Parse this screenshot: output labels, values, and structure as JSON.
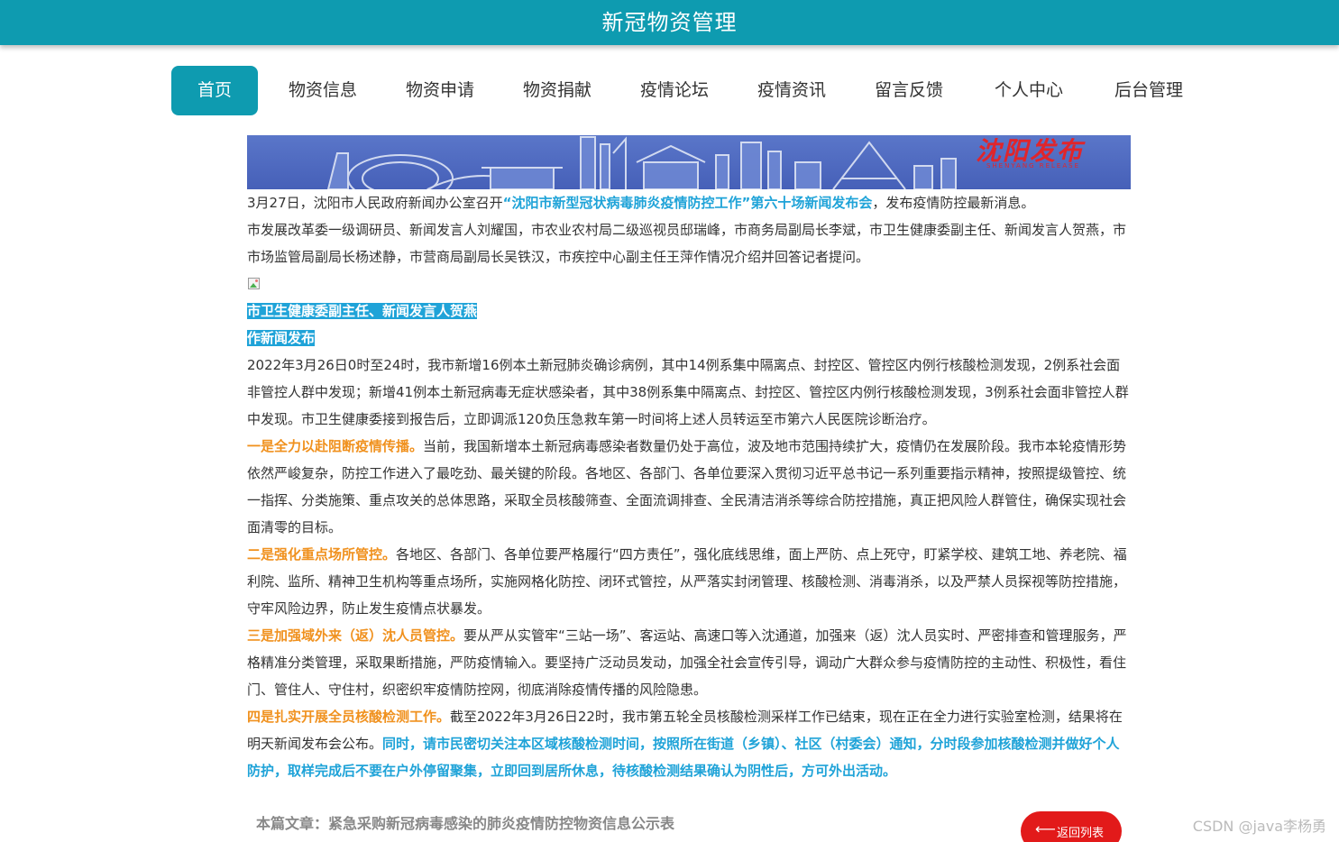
{
  "header": {
    "title": "新冠物资管理",
    "bg_color": "#0e9bb0"
  },
  "nav": {
    "items": [
      {
        "label": "首页",
        "active": true
      },
      {
        "label": "物资信息"
      },
      {
        "label": "物资申请"
      },
      {
        "label": "物资捐献"
      },
      {
        "label": "疫情论坛"
      },
      {
        "label": "疫情资讯"
      },
      {
        "label": "留言反馈"
      },
      {
        "label": "个人中心"
      },
      {
        "label": "后台管理"
      }
    ]
  },
  "banner": {
    "brand": "沈阳发布",
    "brand_sub": "SHENYANG RELEASE"
  },
  "article": {
    "intro_1": "3月27日，沈阳市人民政府新闻办公室召开",
    "intro_link": "“沈阳市新型冠状病毒肺炎疫情防控工作”第六十场新闻发布会",
    "intro_2": "，发布疫情防控最新消息。",
    "speakers": "市发展改革委一级调研员、新闻发言人刘耀国，市农业农村局二级巡视员邸瑞峰，市商务局副局长李斌，市卫生健康委副主任、新闻发言人贺燕，市市场监管局副局长杨述静，市营商局副局长吴铁汉，市疾控中心副主任王萍作情况介绍并回答记者提问。",
    "caption_1": "市卫生健康委副主任、新闻发言人贺燕",
    "caption_2": "作新闻发布",
    "para_cases": "2022年3月26日0时至24时，我市新增16例本土新冠肺炎确诊病例，其中14例系集中隔离点、封控区、管控区内例行核酸检测发现，2例系社会面非管控人群中发现；新增41例本土新冠病毒无症状感染者，其中38例系集中隔离点、封控区、管控区内例行核酸检测发现，3例系社会面非管控人群中发现。市卫生健康委接到报告后，立即调派120负压急救车第一时间将上述人员转运至市第六人民医院诊断治疗。",
    "point1_title": "一是全力以赴阻断疫情传播。",
    "point1_text": "当前，我国新增本土新冠病毒感染者数量仍处于高位，波及地市范围持续扩大，疫情仍在发展阶段。我市本轮疫情形势依然严峻复杂，防控工作进入了最吃劲、最关键的阶段。各地区、各部门、各单位要深入贯彻习近平总书记一系列重要指示精神，按照提级管控、统一指挥、分类施策、重点攻关的总体思路，采取全员核酸筛查、全面流调排查、全民清洁消杀等综合防控措施，真正把风险人群管住，确保实现社会面清零的目标。",
    "point2_title": "二是强化重点场所管控。",
    "point2_text": "各地区、各部门、各单位要严格履行“四方责任”，强化底线思维，面上严防、点上死守，盯紧学校、建筑工地、养老院、福利院、监所、精神卫生机构等重点场所，实施网格化防控、闭环式管控，从严落实封闭管理、核酸检测、消毒消杀，以及严禁人员探视等防控措施，守牢风险边界，防止发生疫情点状暴发。",
    "point3_title": "三是加强域外来（返）沈人员管控。",
    "point3_text": "要从严从实管牢“三站一场”、客运站、高速口等入沈通道，加强来（返）沈人员实时、严密排查和管理服务，严格精准分类管理，采取果断措施，严防疫情输入。要坚持广泛动员发动，加强全社会宣传引导，调动广大群众参与疫情防控的主动性、积极性，看住门、管住人、守住村，织密织牢疫情防控网，彻底消除疫情传播的风险隐患。",
    "point4_title": "四是扎实开展全员核酸检测工作。",
    "point4_text": "截至2022年3月26日22时，我市第五轮全员核酸检测采样工作已结束，现在正在全力进行实验室检测，结果将在明天新闻发布会公布。",
    "point4_notice": "同时，请市民密切关注本区域核酸检测时间，按照所在街道（乡镇）、社区（村委会）通知，分时段参加核酸检测并做好个人防护，取样完成后不要在户外停留聚集，立即回到居所休息，待核酸检测结果确认为阴性后，方可外出活动。"
  },
  "footer": {
    "article_label": "本篇文章：紧急采购新冠病毒感染的肺炎疫情防控物资信息公示表",
    "back_button": "返回列表",
    "back_icon": "arrow-left-icon",
    "watermark": "CSDN @java李杨勇"
  },
  "colors": {
    "accent": "#0e9bb0",
    "link_blue": "#1fa3d8",
    "highlight_orange": "#f0911e",
    "button_red": "#e21a1a"
  }
}
